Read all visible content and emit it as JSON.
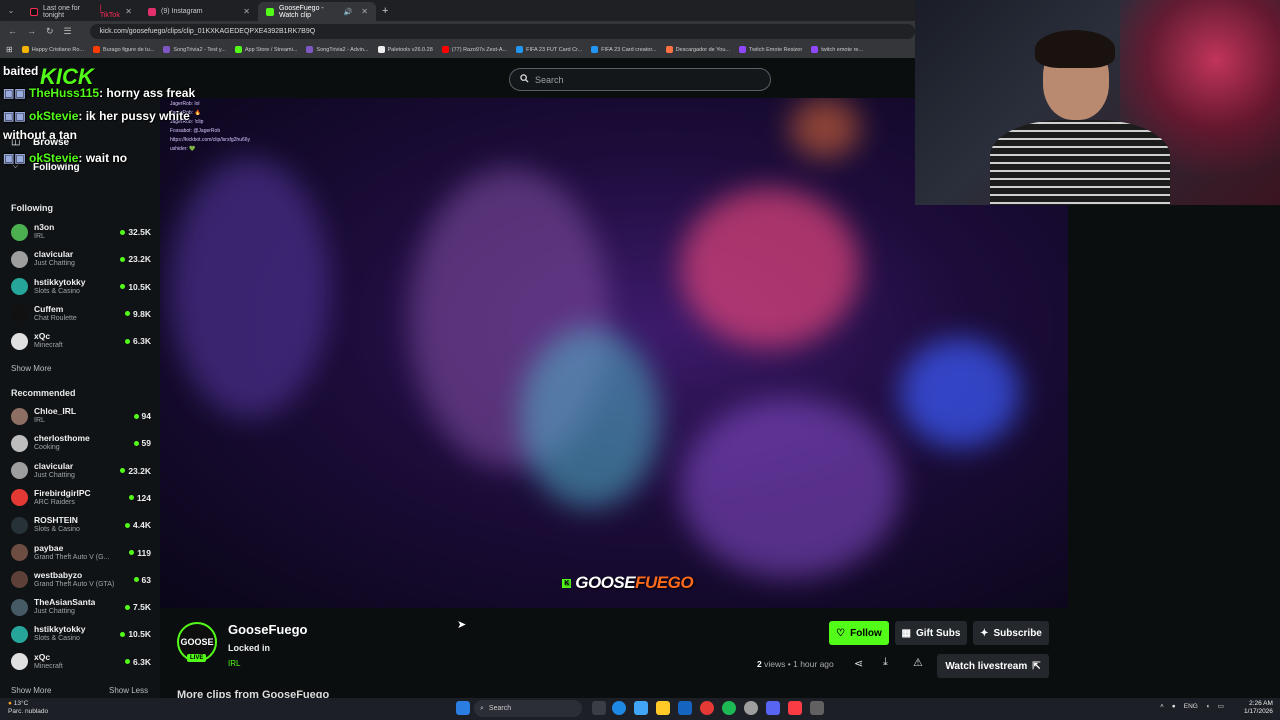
{
  "browser": {
    "tabs": [
      {
        "label": "Last one for tonight",
        "suffix": "| TikTok",
        "color": "#fe2c55"
      },
      {
        "label": "(9) Instagram",
        "suffix": "",
        "color": "#e1306c"
      },
      {
        "label": "GooseFuego - Watch clip",
        "suffix": "",
        "color": "#53fc18"
      }
    ],
    "url": "kick.com/goosefuego/clips/clip_01KXKAGEDEQPXE4392B1RK7B9Q",
    "bookmarks": [
      {
        "label": "Happy Cristiano Ro...",
        "color": "#f4b400"
      },
      {
        "label": "Burago figure de tu...",
        "color": "#ff3d00"
      },
      {
        "label": "SongTrivia2 - Test y...",
        "color": "#7e57c2"
      },
      {
        "label": "App Store / Streami...",
        "color": "#53fc18"
      },
      {
        "label": "SongTrivia2 - Advin...",
        "color": "#7e57c2"
      },
      {
        "label": "Paletools v26.0.28",
        "color": "#eeeeee"
      },
      {
        "label": "(77) Razo97s Zest-A...",
        "color": "#ff0000"
      },
      {
        "label": "FIFA 23 FUT Card Cr...",
        "color": "#2196f3"
      },
      {
        "label": "FIFA 23 Card creator...",
        "color": "#2196f3"
      },
      {
        "label": "Descargador de You...",
        "color": "#ff7043"
      },
      {
        "label": "Twitch Emote Resizer",
        "color": "#9146ff"
      },
      {
        "label": "twitch emote re...",
        "color": "#9146ff"
      }
    ]
  },
  "kick": {
    "logo": "KICK",
    "search_placeholder": "Search",
    "nav": {
      "browse": "Browse",
      "following": "Following"
    }
  },
  "overlay_chat": [
    {
      "user": "baited",
      "msg": ""
    },
    {
      "user": "TheHuss115",
      "msg": ": horny ass freak"
    },
    {
      "user": "okStevie",
      "msg": ": ik her pussy white"
    },
    {
      "user": "",
      "msg": "without a tan"
    },
    {
      "user": "okStevie",
      "msg": ": wait no"
    }
  ],
  "embedded_chat": [
    "JagerRob: lol",
    "JagerRob: 🔥",
    "JagerRob: !clip",
    "Fossabot: @JagerRob",
    "https://kickbot.com/clip/lsrsfg2hu66y",
    "ushider: 💚"
  ],
  "sidebar": {
    "following_title": "Following",
    "following": [
      {
        "name": "n3on",
        "category": "IRL",
        "viewers": "32.5K",
        "color": "#4caf50"
      },
      {
        "name": "clavicular",
        "category": "Just Chatting",
        "viewers": "23.2K",
        "color": "#9e9e9e"
      },
      {
        "name": "hstikkytokky",
        "category": "Slots & Casino",
        "viewers": "10.5K",
        "color": "#26a69a"
      },
      {
        "name": "Cuffem",
        "category": "Chat Roulette",
        "viewers": "9.8K",
        "color": "#111111"
      },
      {
        "name": "xQc",
        "category": "Minecraft",
        "viewers": "6.3K",
        "color": "#e0e0e0"
      }
    ],
    "show_more": "Show More",
    "recommended_title": "Recommended",
    "recommended": [
      {
        "name": "Chloe_IRL",
        "category": "IRL",
        "viewers": "94",
        "color": "#8d6e63"
      },
      {
        "name": "cherlosthome",
        "category": "Cooking",
        "viewers": "59",
        "color": "#bdbdbd"
      },
      {
        "name": "clavicular",
        "category": "Just Chatting",
        "viewers": "23.2K",
        "color": "#9e9e9e"
      },
      {
        "name": "FirebirdgirlPC",
        "category": "ARC Raiders",
        "viewers": "124",
        "color": "#e53935"
      },
      {
        "name": "ROSHTEIN",
        "category": "Slots & Casino",
        "viewers": "4.4K",
        "color": "#263238"
      },
      {
        "name": "paybae",
        "category": "Grand Theft Auto V (G...",
        "viewers": "119",
        "color": "#6d4c41"
      },
      {
        "name": "westbabyzo",
        "category": "Grand Theft Auto V (GTA)",
        "viewers": "63",
        "color": "#5d4037"
      },
      {
        "name": "TheAsianSanta",
        "category": "Just Chatting",
        "viewers": "7.5K",
        "color": "#455a64"
      },
      {
        "name": "hstikkytokky",
        "category": "Slots & Casino",
        "viewers": "10.5K",
        "color": "#26a69a"
      },
      {
        "name": "xQc",
        "category": "Minecraft",
        "viewers": "6.3K",
        "color": "#e0e0e0"
      }
    ],
    "show_more_2": "Show More",
    "show_less": "Show Less"
  },
  "video": {
    "watermark_a": "GOOSE",
    "watermark_b": "FUEGO"
  },
  "clip": {
    "avatar_text": "GOOSE",
    "live_badge": "LIVE",
    "streamer": "GooseFuego",
    "title": "Locked in",
    "category": "IRL",
    "follow": "Follow",
    "gift": "Gift Subs",
    "subscribe": "Subscribe",
    "views_count": "2",
    "views_label": "views",
    "separator": "•",
    "age": "1 hour ago",
    "watch": "Watch livestream",
    "more_clips": "More clips from GooseFuego"
  },
  "taskbar": {
    "weather_temp": "13°C",
    "weather_desc": "Parc. nublado",
    "search": "Search",
    "lang": "ENG",
    "time": "2:26 AM",
    "date": "1/17/2026"
  },
  "colors": {
    "accent": "#53fc18",
    "bg": "#0b0e0f",
    "sidebar": "#101315"
  }
}
